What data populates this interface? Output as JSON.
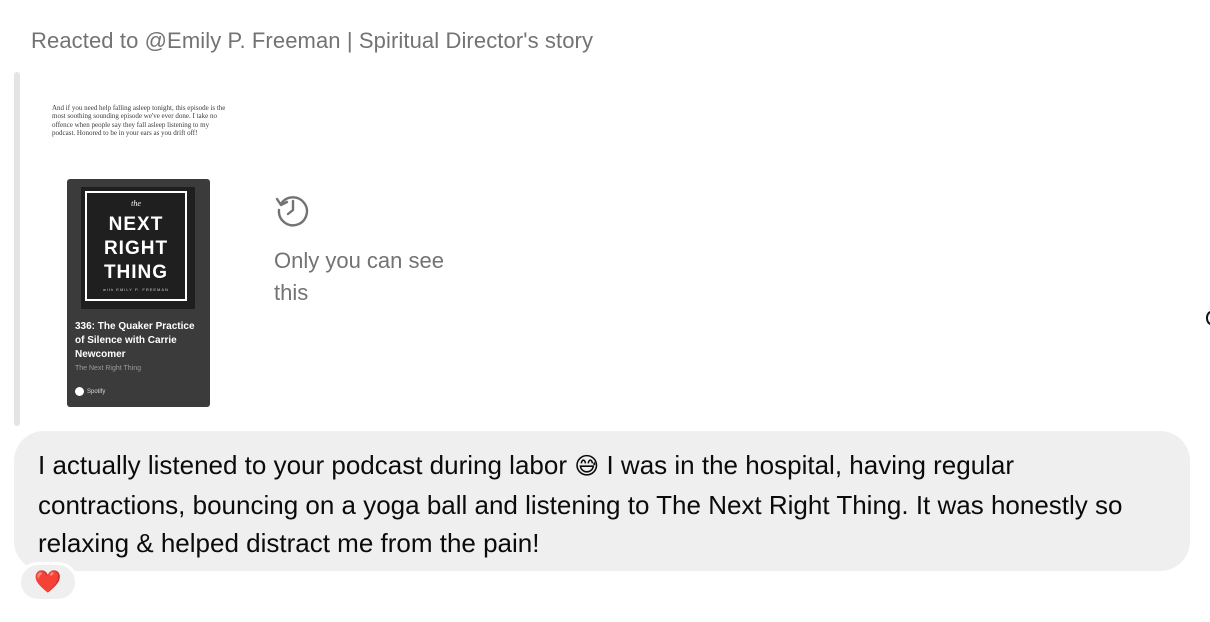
{
  "header": {
    "reacted_to": "Reacted to @Emily P. Freeman | Spiritual Director's story"
  },
  "story": {
    "caption": "And if you need help falling asleep tonight, this episode is the most soothing sounding episode we've ever done. I take no offence when people say they fall asleep listening to my podcast. Honored to be in your ears as you drift off!",
    "cover": {
      "the": "the",
      "title_lines": [
        "NEXT",
        "RIGHT",
        "THING"
      ],
      "author": "with EMILY P. FREEMAN"
    },
    "episode_title": "336: The Quaker Practice of Silence with Carrie Newcomer",
    "show_name": "The Next Right Thing",
    "platform": "Spotify"
  },
  "private_notice": {
    "icon": "history-icon",
    "text": "Only you can see this"
  },
  "message": {
    "text_before_emoji": "I actually listened to your podcast during labor",
    "emoji": "😅",
    "text_after_emoji": "I was in the hospital, having regular contractions, bouncing on a yoga ball and listening to The Next Right Thing. It was honestly so relaxing & helped distract me from the pain!"
  },
  "reaction": {
    "emoji": "❤️",
    "icon": "heart-icon"
  },
  "colors": {
    "muted_text": "#737373",
    "bubble_bg": "#efefef",
    "quote_bar": "#e4e4e4",
    "card_bg": "#3b3b3b"
  }
}
